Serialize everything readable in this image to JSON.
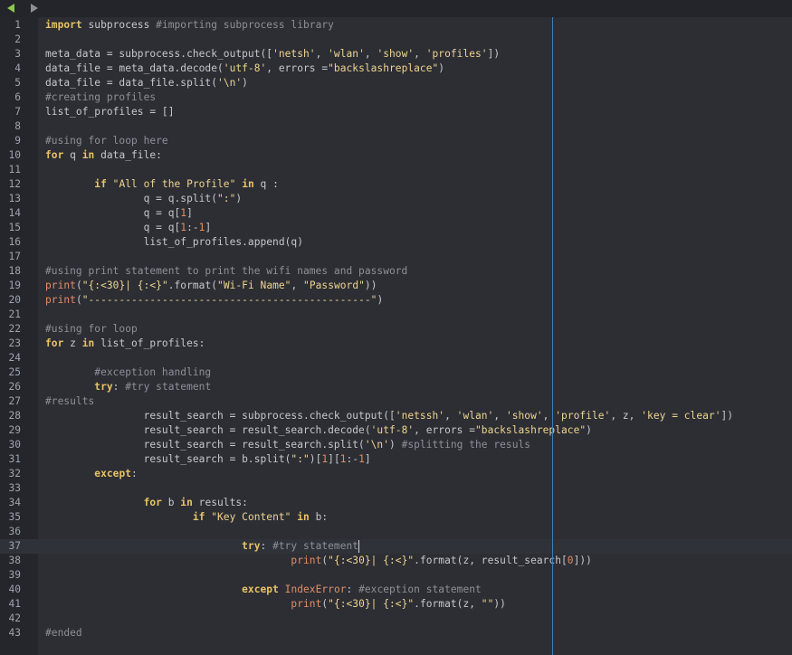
{
  "toolbar": {
    "back_icon": "left-arrow-icon",
    "forward_icon": "right-arrow-icon",
    "back_color": "#8cc653"
  },
  "editor": {
    "language": "python",
    "active_line": 37,
    "lines": [
      [
        [
          "kw",
          "import"
        ],
        [
          "pl",
          " subprocess "
        ],
        [
          "cm",
          "#importing subprocess library"
        ]
      ],
      [],
      [
        [
          "pl",
          "meta_data = subprocess.check_output(["
        ],
        [
          "st",
          "'netsh'"
        ],
        [
          "pl",
          ", "
        ],
        [
          "st",
          "'wlan'"
        ],
        [
          "pl",
          ", "
        ],
        [
          "st",
          "'show'"
        ],
        [
          "pl",
          ", "
        ],
        [
          "st",
          "'profiles'"
        ],
        [
          "pl",
          "])"
        ]
      ],
      [
        [
          "pl",
          "data_file = meta_data.decode("
        ],
        [
          "st",
          "'utf-8'"
        ],
        [
          "pl",
          ", errors ="
        ],
        [
          "st",
          "\"backslashreplace\""
        ],
        [
          "pl",
          ")"
        ]
      ],
      [
        [
          "pl",
          "data_file = data_file.split("
        ],
        [
          "st",
          "'\\n'"
        ],
        [
          "pl",
          ")"
        ]
      ],
      [
        [
          "cm",
          "#creating profiles"
        ]
      ],
      [
        [
          "pl",
          "list_of_profiles = []"
        ]
      ],
      [],
      [
        [
          "cm",
          "#using for loop here"
        ]
      ],
      [
        [
          "kw",
          "for"
        ],
        [
          "pl",
          " q "
        ],
        [
          "kw",
          "in"
        ],
        [
          "pl",
          " data_file:"
        ]
      ],
      [],
      [
        [
          "pl",
          "        "
        ],
        [
          "kw",
          "if"
        ],
        [
          "pl",
          " "
        ],
        [
          "st",
          "\"All of the Profile\""
        ],
        [
          "pl",
          " "
        ],
        [
          "kw",
          "in"
        ],
        [
          "pl",
          " q :"
        ]
      ],
      [
        [
          "pl",
          "                q = q.split("
        ],
        [
          "st",
          "\":\""
        ],
        [
          "pl",
          ")"
        ]
      ],
      [
        [
          "pl",
          "                q = q["
        ],
        [
          "nm",
          "1"
        ],
        [
          "pl",
          "]"
        ]
      ],
      [
        [
          "pl",
          "                q = q["
        ],
        [
          "nm",
          "1"
        ],
        [
          "pl",
          ":-"
        ],
        [
          "nm",
          "1"
        ],
        [
          "pl",
          "]"
        ]
      ],
      [
        [
          "pl",
          "                list_of_profiles.append(q)"
        ]
      ],
      [],
      [
        [
          "cm",
          "#using print statement to print the wifi names and password"
        ]
      ],
      [
        [
          "bi",
          "print"
        ],
        [
          "pl",
          "("
        ],
        [
          "st",
          "\"{:<30}| {:<}\""
        ],
        [
          "pl",
          ".format("
        ],
        [
          "st",
          "\"Wi-Fi Name\""
        ],
        [
          "pl",
          ", "
        ],
        [
          "st",
          "\"Password\""
        ],
        [
          "pl",
          "))"
        ]
      ],
      [
        [
          "bi",
          "print"
        ],
        [
          "pl",
          "("
        ],
        [
          "st",
          "\"----------------------------------------------\""
        ],
        [
          "pl",
          ")"
        ]
      ],
      [],
      [
        [
          "cm",
          "#using for loop"
        ]
      ],
      [
        [
          "kw",
          "for"
        ],
        [
          "pl",
          " z "
        ],
        [
          "kw",
          "in"
        ],
        [
          "pl",
          " list_of_profiles:"
        ]
      ],
      [],
      [
        [
          "pl",
          "        "
        ],
        [
          "cm",
          "#exception handling"
        ]
      ],
      [
        [
          "pl",
          "        "
        ],
        [
          "kw",
          "try"
        ],
        [
          "pl",
          ": "
        ],
        [
          "cm",
          "#try statement"
        ]
      ],
      [
        [
          "cm",
          "#results"
        ]
      ],
      [
        [
          "pl",
          "                result_search = subprocess.check_output(["
        ],
        [
          "st",
          "'netssh'"
        ],
        [
          "pl",
          ", "
        ],
        [
          "st",
          "'wlan'"
        ],
        [
          "pl",
          ", "
        ],
        [
          "st",
          "'show'"
        ],
        [
          "pl",
          ", "
        ],
        [
          "st",
          "'profile'"
        ],
        [
          "pl",
          ", z, "
        ],
        [
          "st",
          "'key = clear'"
        ],
        [
          "pl",
          "])"
        ]
      ],
      [
        [
          "pl",
          "                result_search = result_search.decode("
        ],
        [
          "st",
          "'utf-8'"
        ],
        [
          "pl",
          ", errors ="
        ],
        [
          "st",
          "\"backslashreplace\""
        ],
        [
          "pl",
          ")"
        ]
      ],
      [
        [
          "pl",
          "                result_search = result_search.split("
        ],
        [
          "st",
          "'\\n'"
        ],
        [
          "pl",
          ") "
        ],
        [
          "cm",
          "#splitting the resuls"
        ]
      ],
      [
        [
          "pl",
          "                result_search = b.split("
        ],
        [
          "st",
          "\":\""
        ],
        [
          "pl",
          ")["
        ],
        [
          "nm",
          "1"
        ],
        [
          "pl",
          "]["
        ],
        [
          "nm",
          "1"
        ],
        [
          "pl",
          ":-"
        ],
        [
          "nm",
          "1"
        ],
        [
          "pl",
          "]"
        ]
      ],
      [
        [
          "pl",
          "        "
        ],
        [
          "kw",
          "except"
        ],
        [
          "pl",
          ":"
        ]
      ],
      [],
      [
        [
          "pl",
          "                "
        ],
        [
          "kw",
          "for"
        ],
        [
          "pl",
          " b "
        ],
        [
          "kw",
          "in"
        ],
        [
          "pl",
          " results:"
        ]
      ],
      [
        [
          "pl",
          "                        "
        ],
        [
          "kw",
          "if"
        ],
        [
          "pl",
          " "
        ],
        [
          "st",
          "\"Key Content\""
        ],
        [
          "pl",
          " "
        ],
        [
          "kw",
          "in"
        ],
        [
          "pl",
          " b:"
        ]
      ],
      [],
      [
        [
          "pl",
          "                                "
        ],
        [
          "kw",
          "try"
        ],
        [
          "pl",
          ": "
        ],
        [
          "cm",
          "#try statement"
        ]
      ],
      [
        [
          "pl",
          "                                        "
        ],
        [
          "bi",
          "print"
        ],
        [
          "pl",
          "("
        ],
        [
          "st",
          "\"{:<30}| {:<}\""
        ],
        [
          "pl",
          ".format(z, result_search["
        ],
        [
          "nm",
          "0"
        ],
        [
          "pl",
          "]))"
        ]
      ],
      [],
      [
        [
          "pl",
          "                                "
        ],
        [
          "kw",
          "except"
        ],
        [
          "pl",
          " "
        ],
        [
          "bi",
          "IndexError"
        ],
        [
          "pl",
          ": "
        ],
        [
          "cm",
          "#exception statement"
        ]
      ],
      [
        [
          "pl",
          "                                        "
        ],
        [
          "bi",
          "print"
        ],
        [
          "pl",
          "("
        ],
        [
          "st",
          "\"{:<30}| {:<}\""
        ],
        [
          "pl",
          ".format(z, "
        ],
        [
          "st",
          "\"\""
        ],
        [
          "pl",
          "))"
        ]
      ],
      [],
      [
        [
          "cm",
          "#ended"
        ]
      ]
    ]
  }
}
